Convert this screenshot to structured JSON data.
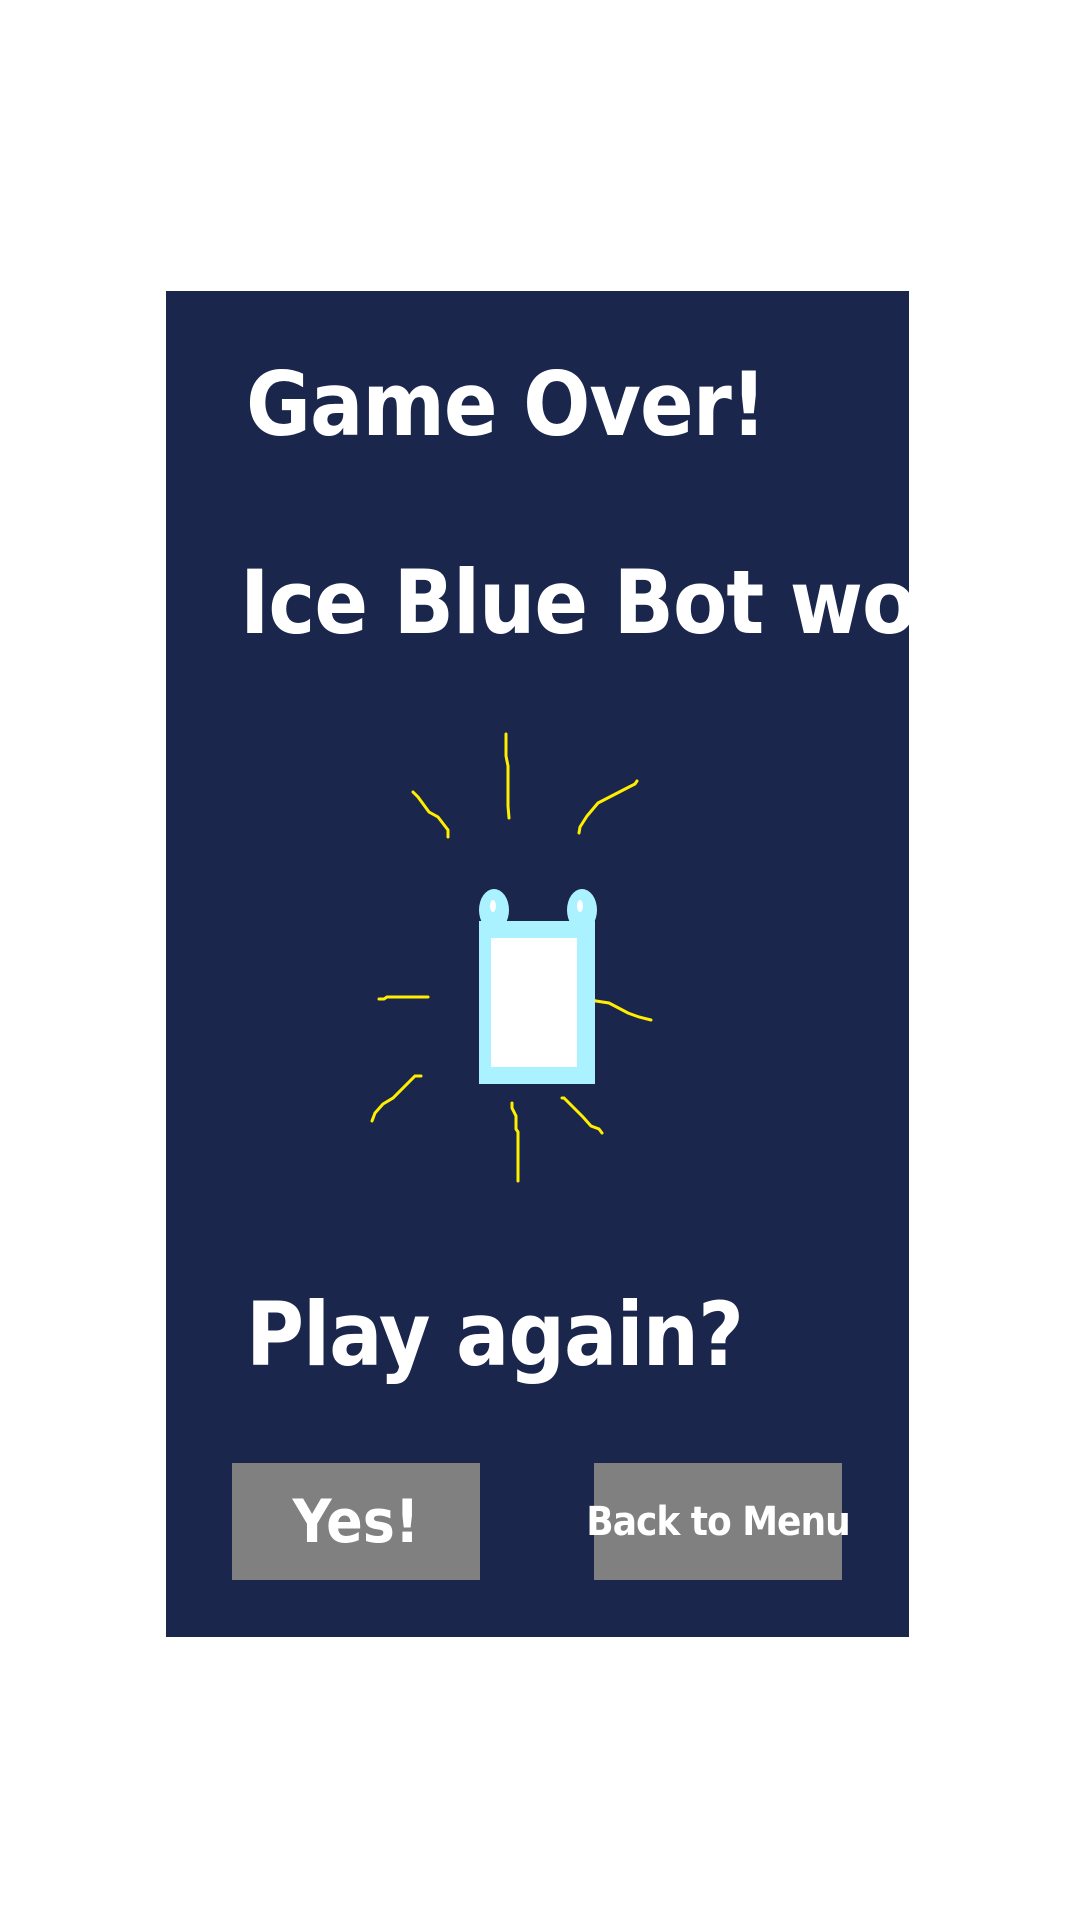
{
  "game_over": {
    "title": "Game Over!",
    "winner_text": "Ice Blue Bot won!",
    "play_again_prompt": "Play again?",
    "yes_label": "Yes!",
    "menu_label": "Back to Menu",
    "winner_sprite_icon": "robot-icon",
    "colors": {
      "panel": "#1a264c",
      "text": "#ffffff",
      "button": "#808080",
      "winner_color": "#aaf2ff",
      "sparkle": "#ffee00"
    }
  }
}
